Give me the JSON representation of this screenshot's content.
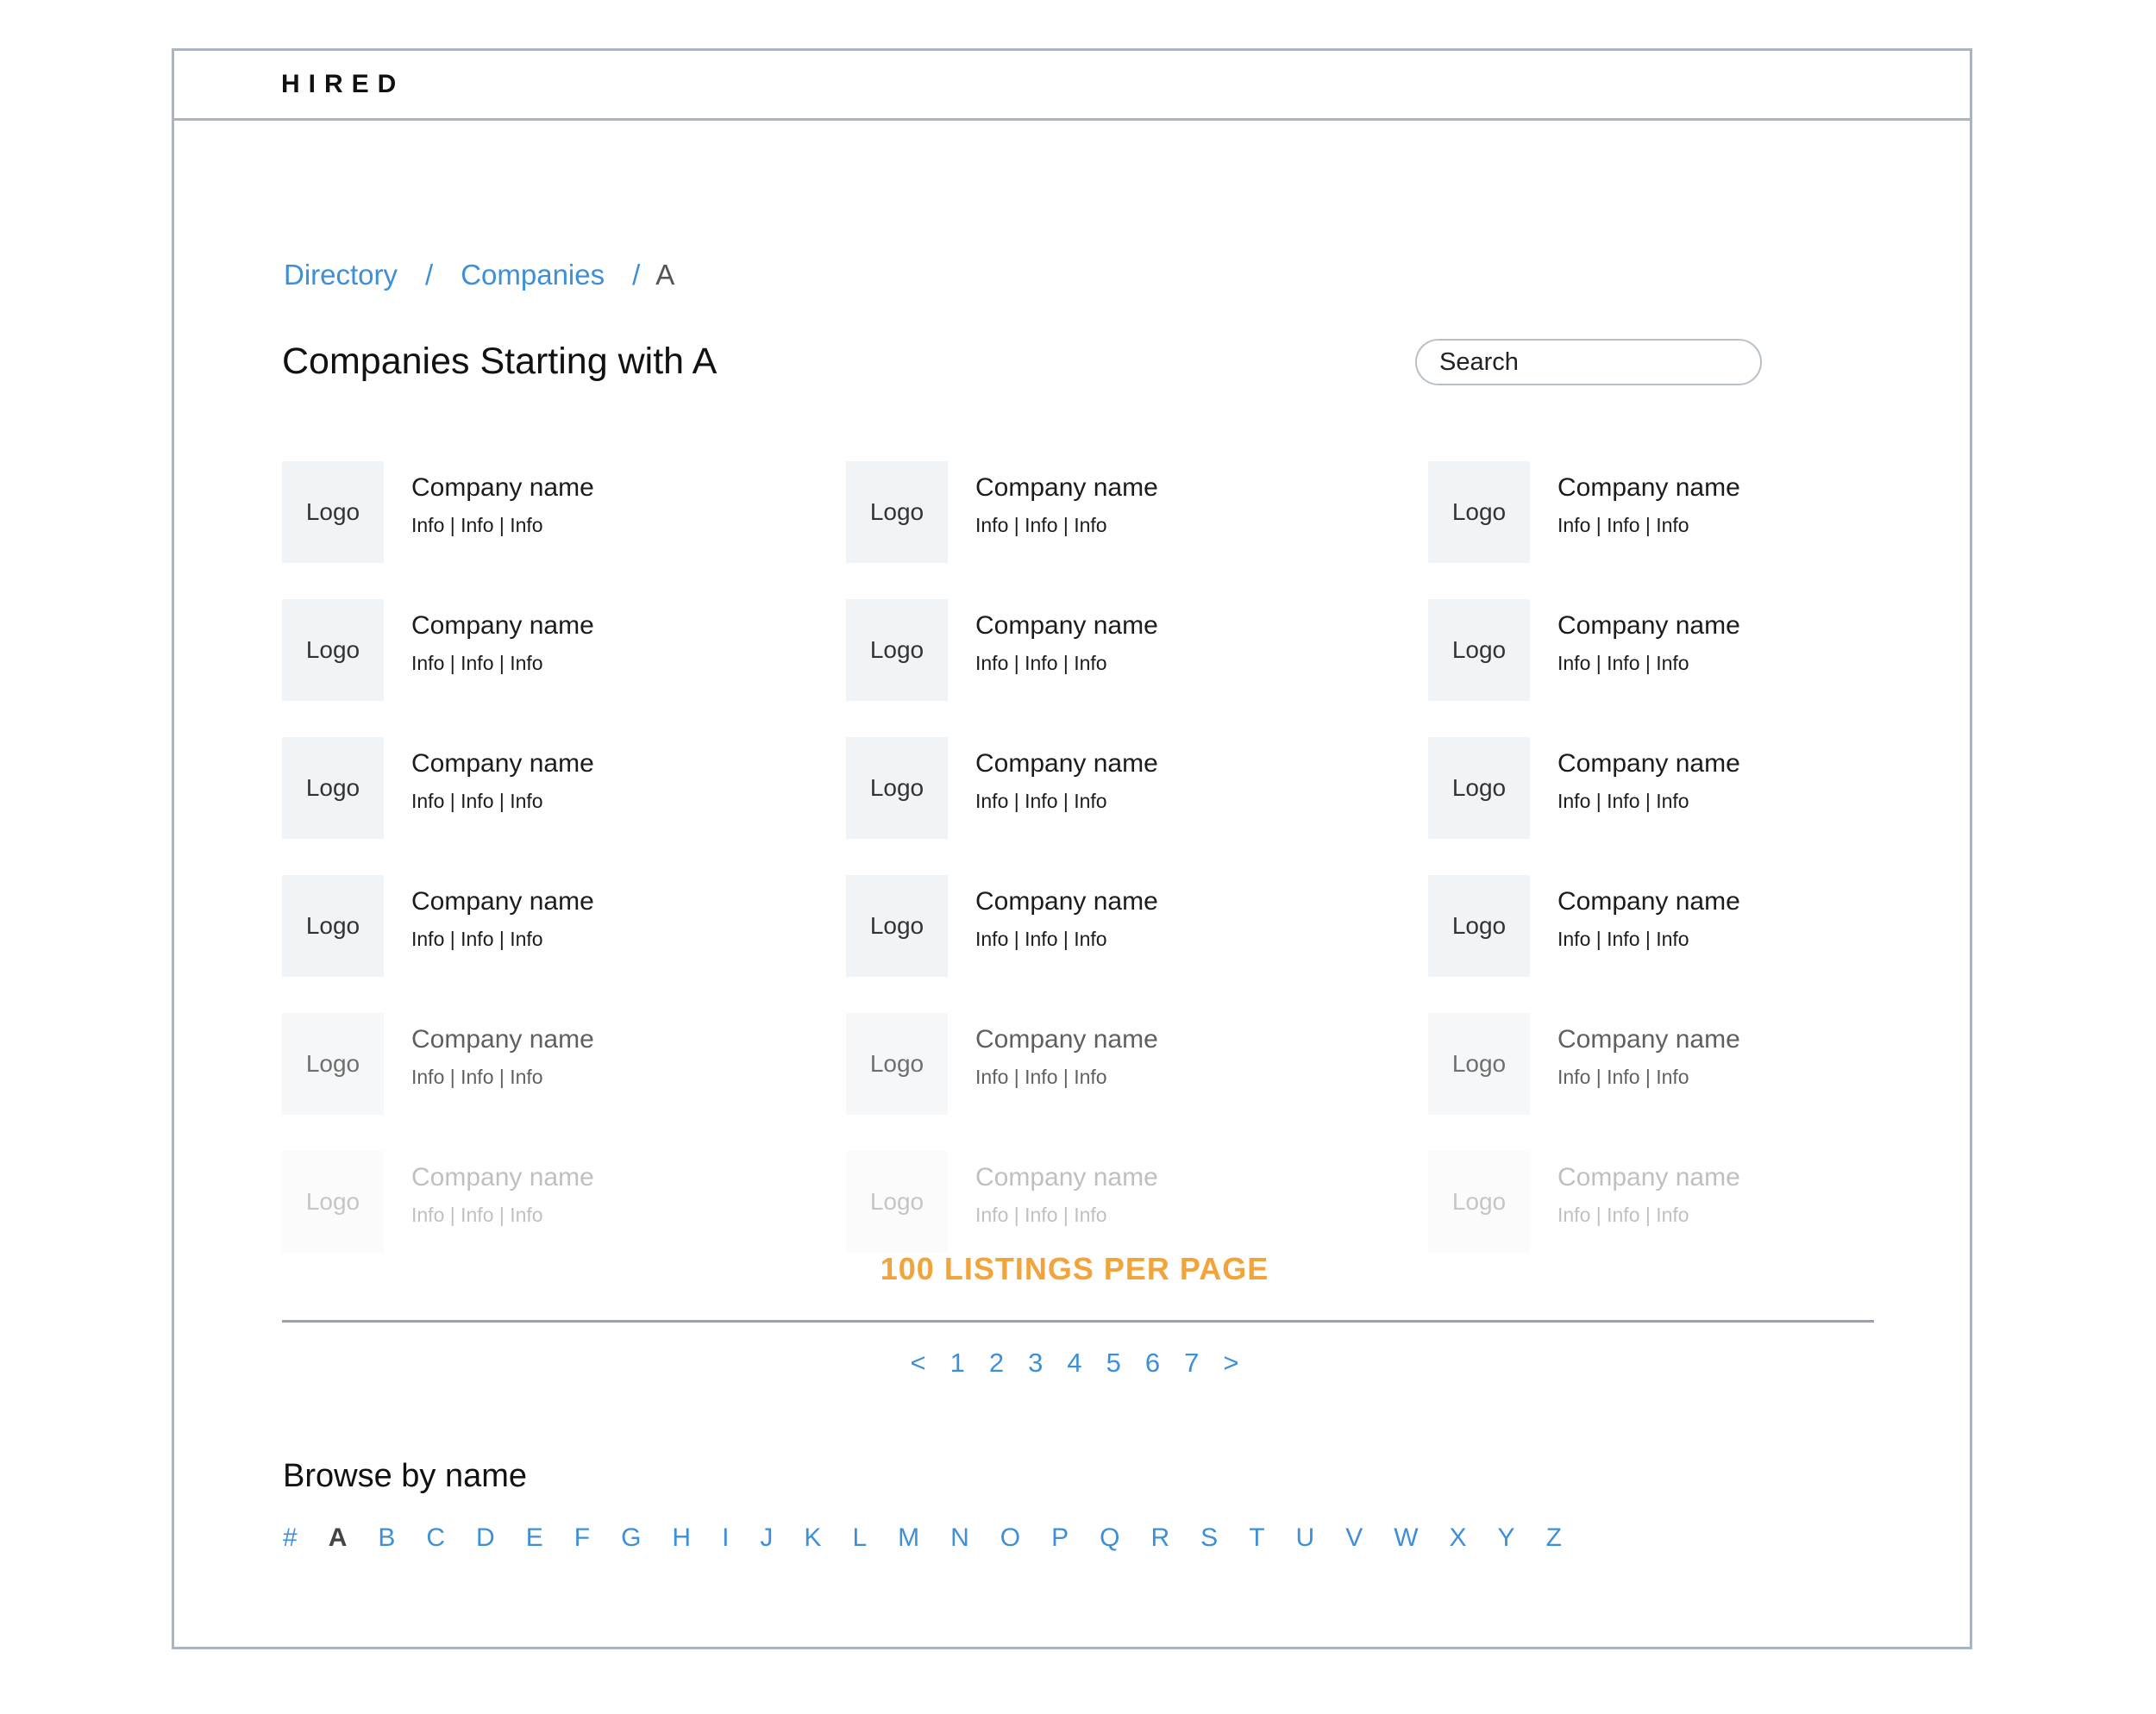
{
  "header": {
    "brand": "HIRED"
  },
  "breadcrumb": {
    "items": [
      "Directory",
      "Companies"
    ],
    "separator": "/",
    "current": "A"
  },
  "page": {
    "title": "Companies Starting with A"
  },
  "search": {
    "placeholder": "Search"
  },
  "company_card": {
    "logo_label": "Logo",
    "name": "Company name",
    "info": "Info | Info | Info"
  },
  "grid": {
    "columns": 3,
    "rows": 6
  },
  "listings_note": "100 LISTINGS PER PAGE",
  "colors": {
    "link": "#3f8fd8",
    "accent": "#f2a33a",
    "border": "#aab5c0",
    "logo_bg": "#f1f4f7"
  },
  "pagination": {
    "prev": "<",
    "pages": [
      "1",
      "2",
      "3",
      "4",
      "5",
      "6",
      "7"
    ],
    "next": ">"
  },
  "browse": {
    "title": "Browse by name",
    "letters": [
      "#",
      "A",
      "B",
      "C",
      "D",
      "E",
      "F",
      "G",
      "H",
      "I",
      "J",
      "K",
      "L",
      "M",
      "N",
      "O",
      "P",
      "Q",
      "R",
      "S",
      "T",
      "U",
      "V",
      "W",
      "X",
      "Y",
      "Z"
    ],
    "current": "A"
  }
}
